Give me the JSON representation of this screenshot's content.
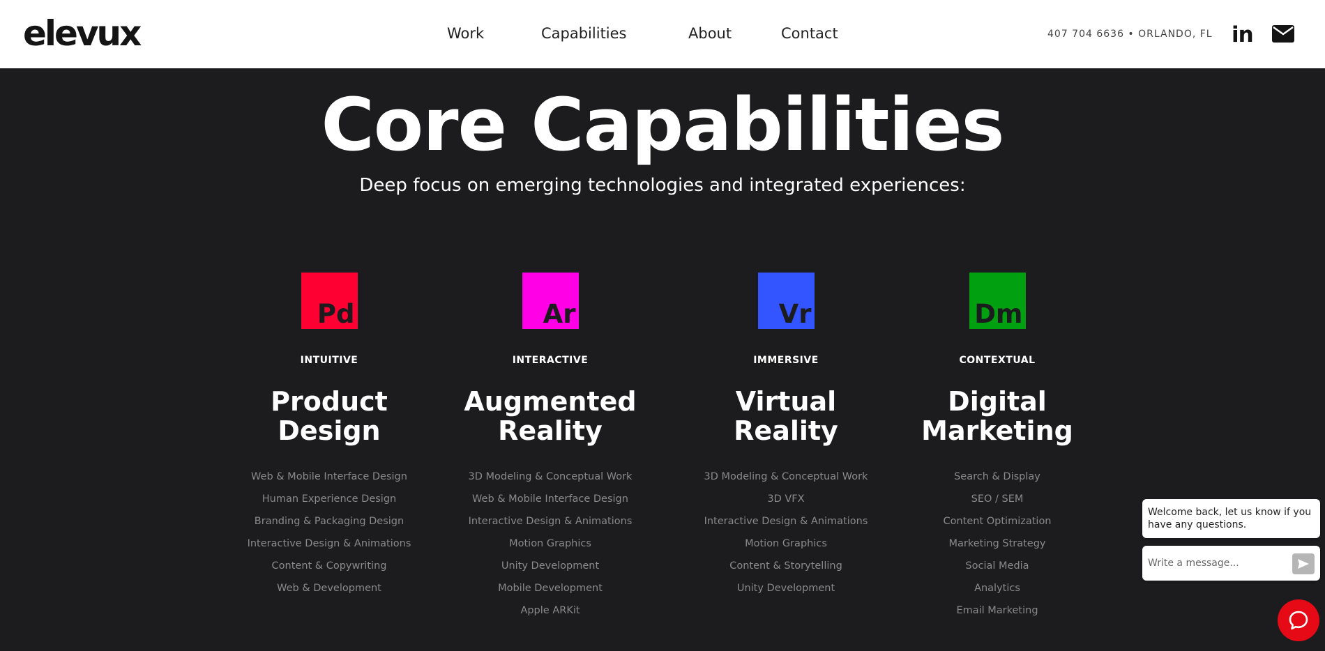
{
  "header": {
    "logo": "elevux",
    "nav": [
      {
        "label": "Work"
      },
      {
        "label": "Capabilities"
      },
      {
        "label": "About"
      },
      {
        "label": "Contact"
      }
    ],
    "contact_info": "407 704 6636 • ORLANDO, FL",
    "icons": [
      "linkedin-icon",
      "email-icon"
    ]
  },
  "hero": {
    "title": "Core Capabilities",
    "subtitle": "Deep focus on emerging technologies and integrated experiences:"
  },
  "capabilities": [
    {
      "abbr": "Pd",
      "color": "#ff0033",
      "kicker": "INTUITIVE",
      "title_line1": "Product",
      "title_line2": "Design",
      "items": [
        "Web & Mobile Interface Design",
        "Human Experience Design",
        "Branding & Packaging Design",
        "Interactive Design & Animations",
        "Content & Copywriting",
        "Web & Development"
      ]
    },
    {
      "abbr": "Ar",
      "color": "#ff00e6",
      "kicker": "INTERACTIVE",
      "title_line1": "Augmented",
      "title_line2": "Reality",
      "items": [
        "3D Modeling & Conceptual Work",
        "Web & Mobile Interface Design",
        "Interactive Design & Animations",
        "Motion Graphics",
        "Unity Development",
        "Mobile Development",
        "Apple ARKit"
      ]
    },
    {
      "abbr": "Vr",
      "color": "#3355ff",
      "kicker": "IMMERSIVE",
      "title_line1": "Virtual",
      "title_line2": "Reality",
      "items": [
        "3D Modeling & Conceptual Work",
        "3D VFX",
        "Interactive Design & Animations",
        "Motion Graphics",
        "Content & Storytelling",
        "Unity Development"
      ]
    },
    {
      "abbr": "Dm",
      "color": "#00a010",
      "kicker": "CONTEXTUAL",
      "title_line1": "Digital",
      "title_line2": "Marketing",
      "items": [
        "Search & Display",
        "SEO / SEM",
        "Content Optimization",
        "Marketing Strategy",
        "Social Media",
        "Analytics",
        "Email Marketing"
      ]
    }
  ],
  "chat": {
    "greeting": "Welcome back, let us know if you have any questions.",
    "placeholder": "Write a message...",
    "accent": "#e60a17"
  }
}
